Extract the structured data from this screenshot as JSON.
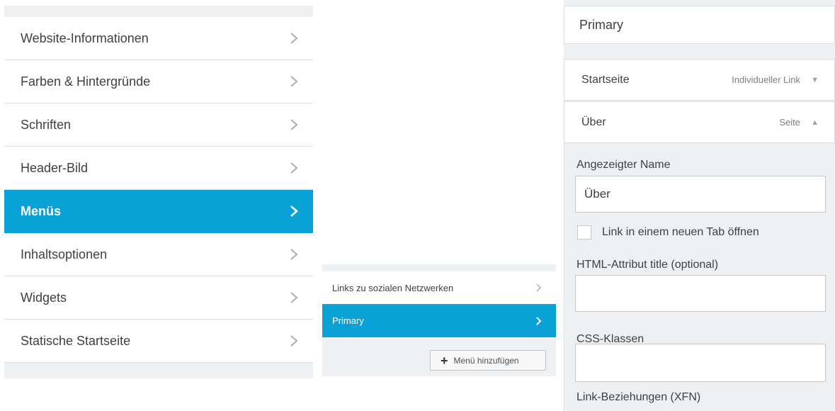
{
  "left_panel": {
    "items": [
      {
        "label": "Website-Informationen"
      },
      {
        "label": "Farben & Hintergründe"
      },
      {
        "label": "Schriften"
      },
      {
        "label": "Header-Bild"
      },
      {
        "label": "Menüs"
      },
      {
        "label": "Inhaltsoptionen"
      },
      {
        "label": "Widgets"
      },
      {
        "label": "Statische Startseite"
      }
    ],
    "active_item": "Menüs"
  },
  "menus_panel": {
    "items": [
      {
        "label": "Links zu sozialen Netzwerken"
      },
      {
        "label": "Primary"
      }
    ],
    "active_item": "Primary",
    "add_button_label": "Menü hinzufügen"
  },
  "editor": {
    "menu_name": "Primary",
    "menu_items": [
      {
        "title": "Startseite",
        "type": "Individueller Link",
        "expanded": false
      },
      {
        "title": "Über",
        "type": "Seite",
        "expanded": true
      }
    ],
    "fields": {
      "display_name_label": "Angezeigter Name",
      "display_name_value": "Über",
      "new_tab_label": "Link in einem neuen Tab öffnen",
      "new_tab_checked": false,
      "title_attr_label": "HTML-Attribut title (optional)",
      "title_attr_value": "",
      "css_classes_label": "CSS-Klassen",
      "css_classes_value": "",
      "xfn_label": "Link-Beziehungen (XFN)"
    }
  },
  "colors": {
    "accent": "#0aa2d6",
    "panel_bg": "#eef1f3",
    "text": "#3c4146"
  }
}
